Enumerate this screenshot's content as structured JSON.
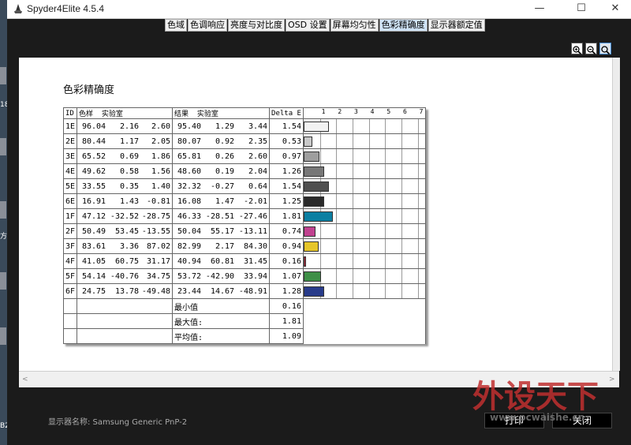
{
  "app": {
    "title": "Spyder4Elite 4.5.4"
  },
  "window_buttons": [
    "—",
    "☐",
    "✕"
  ],
  "tabs": [
    "色域",
    "色调响应",
    "亮度与对比度",
    "OSD 设置",
    "屏幕均匀性",
    "色彩精确度",
    "显示器额定值"
  ],
  "active_tab": 5,
  "report": {
    "title": "色彩精确度",
    "headers": {
      "id": "ID",
      "sample": "色样  实验室",
      "result": "结果  实验室",
      "delta": "Delta E"
    },
    "ticks": [
      "1",
      "2",
      "3",
      "4",
      "5",
      "6",
      "7"
    ],
    "rows": [
      {
        "id": "1E",
        "s": [
          "96.04",
          "2.16",
          "2.60"
        ],
        "r": [
          "95.40",
          "1.29",
          "3.44"
        ],
        "d": "1.54",
        "color": "#f2f2f2"
      },
      {
        "id": "2E",
        "s": [
          "80.44",
          "1.17",
          "2.05"
        ],
        "r": [
          "80.07",
          "0.92",
          "2.35"
        ],
        "d": "0.53",
        "color": "#c8c8c8"
      },
      {
        "id": "3E",
        "s": [
          "65.52",
          "0.69",
          "1.86"
        ],
        "r": [
          "65.81",
          "0.26",
          "2.60"
        ],
        "d": "0.97",
        "color": "#9e9e9e"
      },
      {
        "id": "4E",
        "s": [
          "49.62",
          "0.58",
          "1.56"
        ],
        "r": [
          "48.60",
          "0.19",
          "2.04"
        ],
        "d": "1.26",
        "color": "#777777"
      },
      {
        "id": "5E",
        "s": [
          "33.55",
          "0.35",
          "1.40"
        ],
        "r": [
          "32.32",
          "-0.27",
          "0.64"
        ],
        "d": "1.54",
        "color": "#4f4f4f"
      },
      {
        "id": "6E",
        "s": [
          "16.91",
          "1.43",
          "-0.81"
        ],
        "r": [
          "16.08",
          "1.47",
          "-2.01"
        ],
        "d": "1.25",
        "color": "#2a2a2a"
      },
      {
        "id": "1F",
        "s": [
          "47.12",
          "-32.52",
          "-28.75"
        ],
        "r": [
          "46.33",
          "-28.51",
          "-27.46"
        ],
        "d": "1.81",
        "color": "#0b7fa2"
      },
      {
        "id": "2F",
        "s": [
          "50.49",
          "53.45",
          "-13.55"
        ],
        "r": [
          "50.04",
          "55.17",
          "-13.11"
        ],
        "d": "0.74",
        "color": "#c0418f"
      },
      {
        "id": "3F",
        "s": [
          "83.61",
          "3.36",
          "87.02"
        ],
        "r": [
          "82.99",
          "2.17",
          "84.30"
        ],
        "d": "0.94",
        "color": "#e5c52a"
      },
      {
        "id": "4F",
        "s": [
          "41.05",
          "60.75",
          "31.17"
        ],
        "r": [
          "40.94",
          "60.81",
          "31.45"
        ],
        "d": "0.16",
        "color": "#b7263a"
      },
      {
        "id": "5F",
        "s": [
          "54.14",
          "-40.76",
          "34.75"
        ],
        "r": [
          "53.72",
          "-42.90",
          "33.94"
        ],
        "d": "1.07",
        "color": "#3e8f47"
      },
      {
        "id": "6F",
        "s": [
          "24.75",
          "13.78",
          "-49.48"
        ],
        "r": [
          "23.44",
          "14.67",
          "-48.91"
        ],
        "d": "1.28",
        "color": "#283b8a"
      }
    ],
    "summary": [
      {
        "label": "最小值",
        "value": "0.16"
      },
      {
        "label": "最大值:",
        "value": "1.81"
      },
      {
        "label": "平均值:",
        "value": "1.09"
      }
    ],
    "chart_max": 7.5
  },
  "footer": {
    "monitor_label": "显示器名称: Samsung Generic PnP-2",
    "print": "打印",
    "close": "关闭"
  },
  "desktop": {
    "side_labels": [
      "18",
      "方",
      "B2"
    ]
  },
  "watermark": {
    "main": "外设天下",
    "url": "www.pcwaishe.cn"
  }
}
